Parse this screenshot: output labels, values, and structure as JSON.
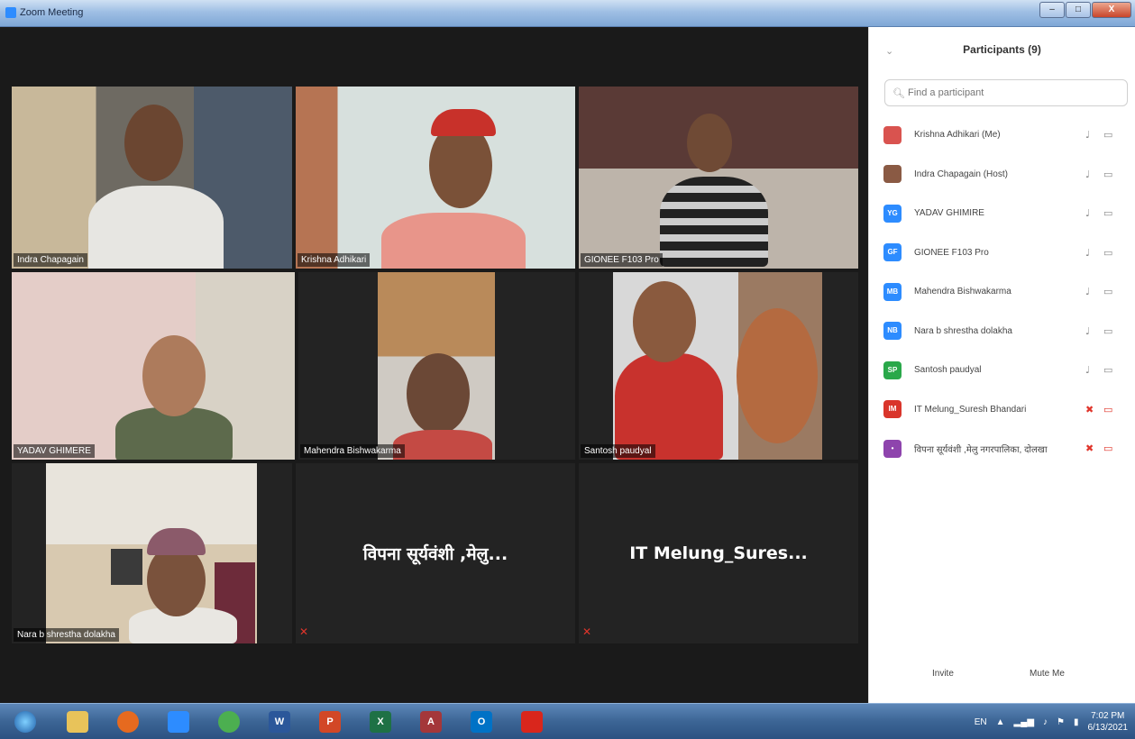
{
  "window": {
    "title": "Zoom Meeting",
    "btn_min": "–",
    "btn_max": "□",
    "btn_close": "X"
  },
  "tiles": [
    {
      "name": "Indra Chapagain"
    },
    {
      "name": "Krishna Adhikari"
    },
    {
      "name": "GIONEE F103 Pro"
    },
    {
      "name": "YADAV GHIMERE"
    },
    {
      "name": "Mahendra Bishwakarma"
    },
    {
      "name": "Santosh paudyal"
    },
    {
      "name": "Nara b shrestha dolakha"
    },
    {
      "display": "विपना सूर्यवंशी ,मेलु..."
    },
    {
      "display": "IT  Melung_Sures..."
    }
  ],
  "panel": {
    "title": "Participants (9)",
    "collapse": "⌄",
    "search_placeholder": "Find a participant",
    "invite": "Invite",
    "mute_me": "Mute Me",
    "participants": [
      {
        "name": "Krishna Adhikari (Me)",
        "initials": "",
        "color": "#d9534f",
        "mic": "on",
        "cam": "on"
      },
      {
        "name": "Indra Chapagain (Host)",
        "initials": "",
        "color": "#8a5a44",
        "mic": "on",
        "cam": "on"
      },
      {
        "name": "YADAV GHIMIRE",
        "initials": "YG",
        "color": "#2d8cff",
        "mic": "on",
        "cam": "on"
      },
      {
        "name": "GIONEE F103 Pro",
        "initials": "GF",
        "color": "#2d8cff",
        "mic": "on",
        "cam": "on"
      },
      {
        "name": "Mahendra Bishwakarma",
        "initials": "MB",
        "color": "#2d8cff",
        "mic": "on",
        "cam": "on"
      },
      {
        "name": "Nara b shrestha dolakha",
        "initials": "NB",
        "color": "#2d8cff",
        "mic": "on",
        "cam": "on"
      },
      {
        "name": "Santosh paudyal",
        "initials": "SP",
        "color": "#2aa84a",
        "mic": "on",
        "cam": "on"
      },
      {
        "name": "IT Melung_Suresh Bhandari",
        "initials": "IM",
        "color": "#d9352b",
        "mic": "off",
        "cam": "off"
      },
      {
        "name": "विपना सूर्यवंशी ,मेलु नगरपालिका, दोलखा",
        "initials": "•",
        "color": "#8e44ad",
        "mic": "off",
        "cam": "off"
      }
    ]
  },
  "taskbar": {
    "lang": "EN",
    "time": "7:02 PM",
    "date": "6/13/2021",
    "apps": [
      {
        "label": "",
        "color": "#2f7fd6"
      },
      {
        "label": "",
        "color": "#e8c35a"
      },
      {
        "label": "",
        "color": "#e66a1f"
      },
      {
        "label": "",
        "color": "#2d8cff"
      },
      {
        "label": "",
        "color": "#4caf50"
      },
      {
        "label": "W",
        "color": "#2b579a"
      },
      {
        "label": "P",
        "color": "#d24726"
      },
      {
        "label": "X",
        "color": "#1e7145"
      },
      {
        "label": "A",
        "color": "#a4373a"
      },
      {
        "label": "O",
        "color": "#0072c6"
      },
      {
        "label": "",
        "color": "#d9261c"
      }
    ]
  }
}
